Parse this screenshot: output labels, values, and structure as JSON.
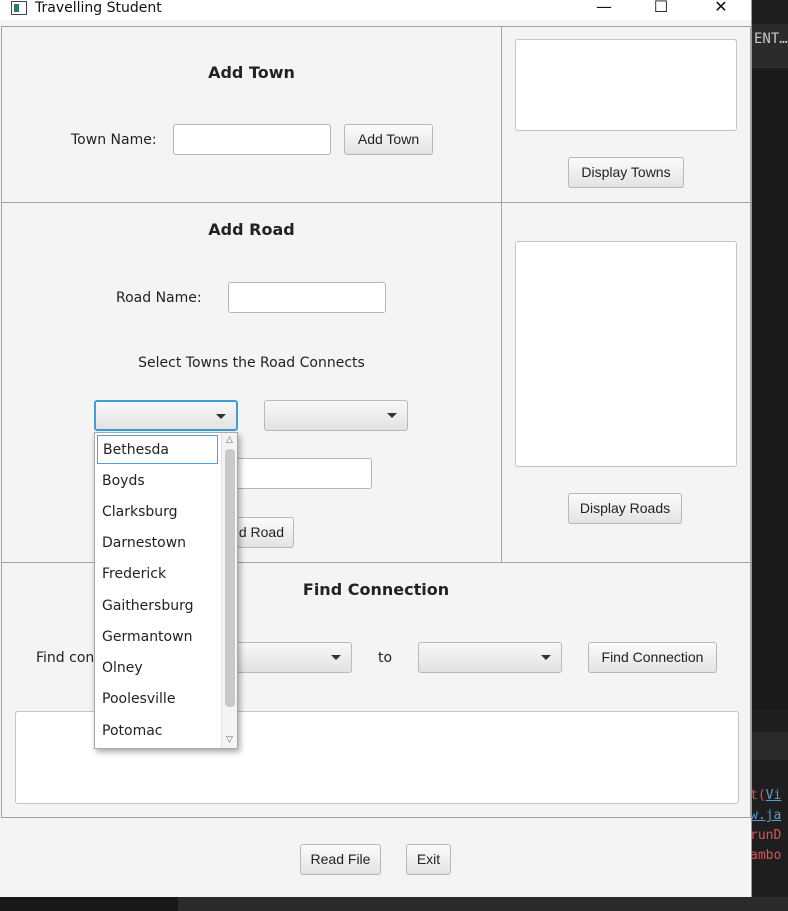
{
  "window": {
    "title": "Travelling Student"
  },
  "ide": {
    "tab_fragment": "ENT…",
    "console_lines": [
      "t(Vi",
      "w.ja",
      "runD",
      "ambo"
    ]
  },
  "add_town": {
    "heading": "Add Town",
    "name_label": "Town Name:",
    "name_value": "",
    "button": "Add Town"
  },
  "towns_panel": {
    "button": "Display Towns"
  },
  "add_road": {
    "heading": "Add Road",
    "name_label": "Road Name:",
    "name_value": "",
    "select_label": "Select Towns the Road Connects",
    "button_partial": "d Road"
  },
  "roads_panel": {
    "button": "Display Roads"
  },
  "dropdown": {
    "options": [
      "Bethesda",
      "Boyds",
      "Clarksburg",
      "Darnestown",
      "Frederick",
      "Gaithersburg",
      "Germantown",
      "Olney",
      "Poolesville",
      "Potomac"
    ],
    "highlighted": "Bethesda"
  },
  "find_connection": {
    "heading": "Find Connection",
    "label_partial": "Find con",
    "to_label": "to",
    "button": "Find Connection"
  },
  "footer": {
    "read_file": "Read File",
    "exit": "Exit"
  }
}
